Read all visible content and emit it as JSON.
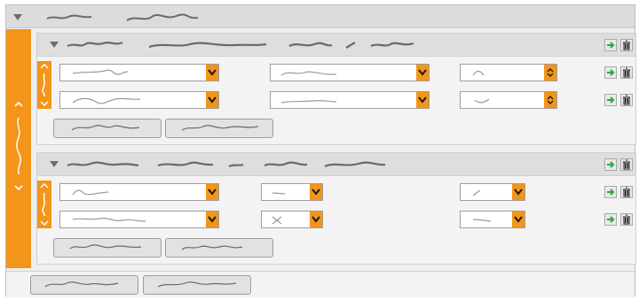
{
  "app": {
    "title": "",
    "colors": {
      "accent": "#f39519",
      "frame_bg": "#efefef",
      "header_bg": "#dcdcdc",
      "arrow_green": "#2faa3a"
    }
  },
  "icons": {
    "collapse": "triangle-down-icon",
    "move": "green-arrow-icon",
    "delete": "trash-icon",
    "dropdown": "chevron-down-icon",
    "stepper": "stepper-icon"
  },
  "groups": [
    {
      "title": "",
      "rows": [
        {
          "field1": "",
          "field2": "",
          "field3": ""
        },
        {
          "field1": "",
          "field2": "",
          "field3": ""
        }
      ],
      "buttons": [
        "",
        ""
      ]
    },
    {
      "title": "",
      "rows": [
        {
          "field1": "",
          "field2": "",
          "field3": ""
        },
        {
          "field1": "",
          "field2": "",
          "field3": ""
        }
      ],
      "buttons": [
        "",
        ""
      ]
    }
  ],
  "footer": {
    "buttons": [
      "",
      ""
    ]
  }
}
